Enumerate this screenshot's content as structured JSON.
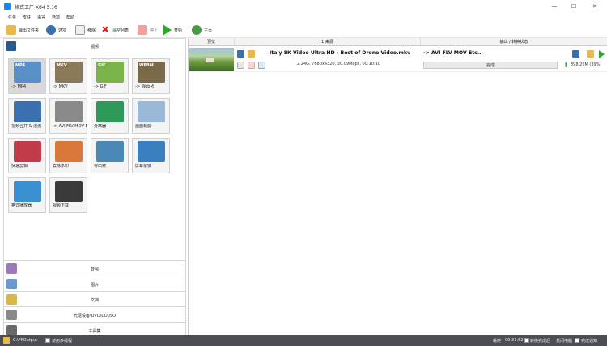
{
  "window": {
    "title": "格式工厂 X64 5.16",
    "minimize": "—",
    "maximize": "☐",
    "close": "✕"
  },
  "menu": [
    "任务",
    "皮肤",
    "语言",
    "选项",
    "帮助"
  ],
  "toolbar": {
    "output_folder": "输出文件夹",
    "options": "选项",
    "remove": "移除",
    "clear_list": "清空列表",
    "stop": "停止",
    "start": "开始",
    "home": "主页"
  },
  "left": {
    "header": "视频",
    "tiles": [
      {
        "label": "-> MP4",
        "badge": "MP4",
        "color": "#5a8fc8",
        "selected": true
      },
      {
        "label": "-> MKV",
        "badge": "MKV",
        "color": "#8a7a5a"
      },
      {
        "label": "-> GIF",
        "badge": "GIF",
        "color": "#7ab34a"
      },
      {
        "label": "-> WebM",
        "badge": "WEBM",
        "color": "#7a6a4a"
      },
      {
        "label": "视频合并 & 混流",
        "color": "#3a6fb0"
      },
      {
        "label": "-> AVI FLV MOV Etc...",
        "color": "#8a8a8a"
      },
      {
        "label": "分离器",
        "color": "#2d9a5a"
      },
      {
        "label": "画面裁剪",
        "color": "#9ab8d8"
      },
      {
        "label": "快速剪辑",
        "color": "#c03a4a"
      },
      {
        "label": "去除水印",
        "color": "#d9783a"
      },
      {
        "label": "导出帧",
        "color": "#4a88b8"
      },
      {
        "label": "屏幕录像",
        "color": "#3a7fc0"
      },
      {
        "label": "格式播放器",
        "color": "#3a8fd0"
      },
      {
        "label": "视频下载",
        "color": "#3a3a3a"
      }
    ],
    "sections": [
      {
        "label": "音频",
        "color": "#9a7ab8"
      },
      {
        "label": "图片",
        "color": "#6a9ac8"
      },
      {
        "label": "文档",
        "color": "#d8b84a"
      },
      {
        "label": "光驱设备\\DVD\\CD\\ISO",
        "color": "#8a8a8a"
      },
      {
        "label": "工具集",
        "color": "#6a6a6a"
      }
    ]
  },
  "table": {
    "col_preview": "预览",
    "col_source": "1 来源",
    "col_output": "输出 / 转换状态",
    "task": {
      "filename": "Italy 8K Video Ultra HD - Best of Drone Video.mkv",
      "info": "2.24G, 7680x4320, 30.09Mbps, 00:10:10",
      "target": "-> AVI FLV MOV Etc...",
      "status": "完成",
      "output_size": "898.29M",
      "output_pct": "(39%)",
      "progress": 1.0
    }
  },
  "statusbar": {
    "output_path": "C:\\FFOutput",
    "multithread": "使用多线程",
    "elapsed_label": "耗时",
    "elapsed": "00:31:52",
    "after_convert": "转换完成后",
    "shutdown": "关闭电脑",
    "notify": "完成通知"
  }
}
